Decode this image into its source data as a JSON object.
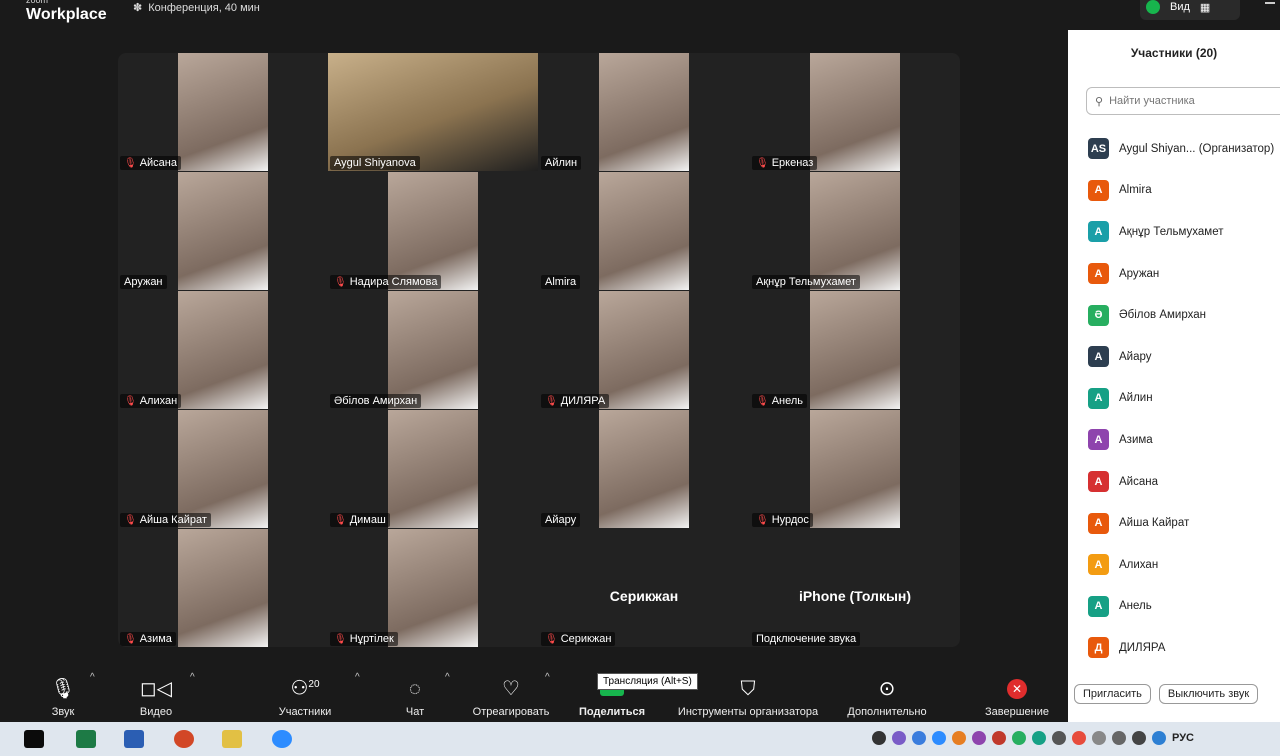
{
  "app": {
    "brand_small": "zoom",
    "brand": "Workplace",
    "meeting_title": "Конференция, 40 мин",
    "view_label": "Вид"
  },
  "tiles": [
    {
      "name": "Айсана",
      "muted": true
    },
    {
      "name": "Aygul Shiyanova",
      "muted": false
    },
    {
      "name": "Айлин",
      "muted": false
    },
    {
      "name": "Еркеназ",
      "muted": true
    },
    {
      "name": "Аружан",
      "muted": false
    },
    {
      "name": "Надира Слямова",
      "muted": true
    },
    {
      "name": "Almira",
      "muted": false
    },
    {
      "name": "Ақнұр Тельмухамет",
      "muted": false
    },
    {
      "name": "Алихан",
      "muted": true
    },
    {
      "name": "Әбілов Амирхан",
      "muted": false
    },
    {
      "name": "ДИЛЯРА",
      "muted": true
    },
    {
      "name": "Анель",
      "muted": true
    },
    {
      "name": "Айша Кайрат",
      "muted": true
    },
    {
      "name": "Димаш",
      "muted": true
    },
    {
      "name": "Айару",
      "muted": false
    },
    {
      "name": "Нурдос",
      "muted": true
    },
    {
      "name": "Азима",
      "muted": true
    },
    {
      "name": "Нұртілек",
      "muted": true
    },
    {
      "name": "Серикжан",
      "muted": true,
      "center_label": "Серикжан"
    },
    {
      "name": "Подключение звука",
      "muted": false,
      "center_label": "iPhone (Толкын)"
    }
  ],
  "toolbar": {
    "audio": "Звук",
    "video": "Видео",
    "participants": "Участники",
    "participants_count": "20",
    "chat": "Чат",
    "react": "Отреагировать",
    "share": "Поделиться",
    "host_tools": "Инструменты организатора",
    "more": "Дополнительно",
    "end": "Завершение",
    "share_tooltip": "Трансляция (Alt+S)"
  },
  "panel": {
    "title": "Участники (20)",
    "search_placeholder": "Найти участника",
    "invite": "Пригласить",
    "mute_all": "Выключить звук",
    "participants": [
      {
        "initial": "AS",
        "name": "Aygul Shiyan... (Организатор)",
        "color": "#2d3e50"
      },
      {
        "initial": "A",
        "name": "Almira",
        "color": "#e8590c"
      },
      {
        "initial": "A",
        "name": "Ақнұр Тельмухамет",
        "color": "#1a9fa8"
      },
      {
        "initial": "A",
        "name": "Аружан",
        "color": "#e8590c"
      },
      {
        "initial": "Ә",
        "name": "Әбілов Амирхан",
        "color": "#27ae60"
      },
      {
        "initial": "A",
        "name": "Айару",
        "color": "#2d3e50"
      },
      {
        "initial": "A",
        "name": "Айлин",
        "color": "#16a085"
      },
      {
        "initial": "A",
        "name": "Азима",
        "color": "#8e44ad"
      },
      {
        "initial": "A",
        "name": "Айсана",
        "color": "#d63031"
      },
      {
        "initial": "A",
        "name": "Айша Кайрат",
        "color": "#e8590c"
      },
      {
        "initial": "A",
        "name": "Алихан",
        "color": "#f39c12"
      },
      {
        "initial": "A",
        "name": "Анель",
        "color": "#16a085"
      },
      {
        "initial": "Д",
        "name": "ДИЛЯРА",
        "color": "#e8590c"
      }
    ]
  },
  "taskbar": {
    "lang": "РУС"
  }
}
